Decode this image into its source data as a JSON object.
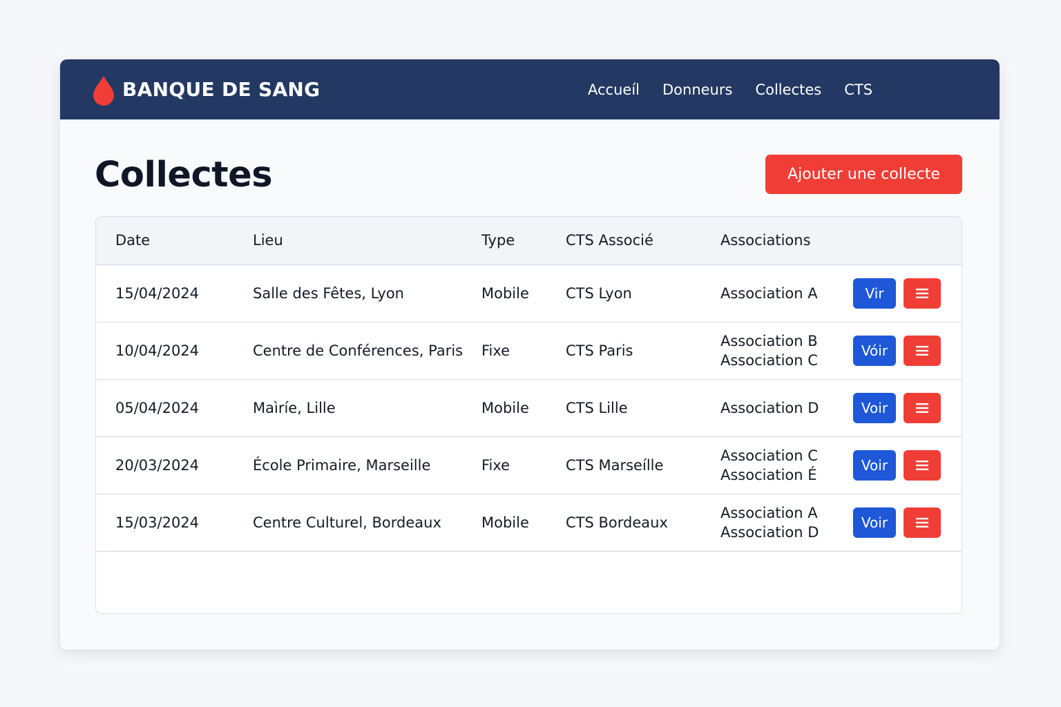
{
  "brand": {
    "name": "BANQUE DE SANG",
    "icon": "blood-drop-icon",
    "icon_color": "#f03e36"
  },
  "nav": {
    "items": [
      {
        "label": "Accueíl"
      },
      {
        "label": "Donneurs"
      },
      {
        "label": "Collectes"
      },
      {
        "label": "CTS"
      }
    ]
  },
  "page": {
    "title": "Collectes",
    "add_button_label": "Ajouter une collecte"
  },
  "table": {
    "columns": [
      "Date",
      "Lieu",
      "Type",
      "CTS Associé",
      "Associations"
    ],
    "rows": [
      {
        "date": "15/04/2024",
        "lieu": "Salle des Fêtes, Lyon",
        "type": "Mobile",
        "cts": "CTS Lyon",
        "associations": [
          "Association A",
          ""
        ],
        "view_label": "Vir"
      },
      {
        "date": "10/04/2024",
        "lieu": "Centre de Conférences, Paris",
        "type": "Fixe",
        "cts": "CTS Paris",
        "associations": [
          "Association B",
          "Association C"
        ],
        "view_label": "Vóir"
      },
      {
        "date": "05/04/2024",
        "lieu": "Maìríe, Lille",
        "type": "Mobile",
        "cts": "CTS Lille",
        "associations": [
          "Association D",
          ""
        ],
        "view_label": "Voir"
      },
      {
        "date": "20/03/2024",
        "lieu": "École Primaire, Marseille",
        "type": "Fixe",
        "cts": "CTS Marseílle",
        "associations": [
          "Association C",
          "Association É"
        ],
        "view_label": "Voir"
      },
      {
        "date": "15/03/2024",
        "lieu": "Centre Culturel, Bordeaux",
        "type": "Mobile",
        "cts": "CTS Bordeaux",
        "associations": [
          "Association A",
          "Association D"
        ],
        "view_label": "Voir"
      }
    ],
    "menu_icon": "hamburger-menu-icon"
  },
  "colors": {
    "navbar": "#233862",
    "danger": "#f03e36",
    "primary": "#1e58d8"
  }
}
